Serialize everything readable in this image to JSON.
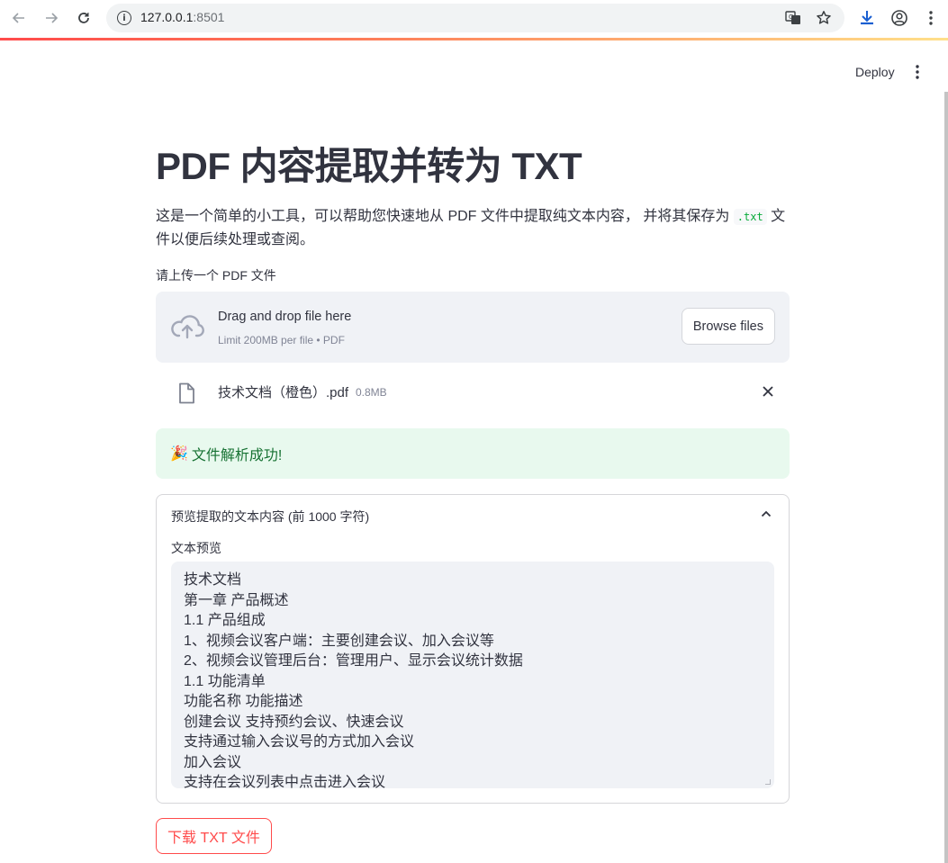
{
  "browser": {
    "url_host": "127.0.0.1",
    "url_port": ":8501"
  },
  "header": {
    "deploy_label": "Deploy"
  },
  "main": {
    "title": "PDF 内容提取并转为 TXT",
    "description_before": "这是一个简单的小工具，可以帮助您快速地从 PDF 文件中提取纯文本内容， 并将其保存为 ",
    "description_code": ".txt",
    "description_after": " 文件以便后续处理或查阅。",
    "upload_label": "请上传一个 PDF 文件",
    "dropzone": {
      "title": "Drag and drop file here",
      "subtitle": "Limit 200MB per file • PDF",
      "browse_label": "Browse files"
    },
    "file": {
      "name": "技术文档（橙色）.pdf",
      "size": "0.8MB"
    },
    "success": {
      "emoji": "🎉",
      "text": "文件解析成功!"
    },
    "expander": {
      "title": "预览提取的文本内容 (前 1000 字符)",
      "textarea_label": "文本预览",
      "lines": [
        "技术文档",
        "第一章 产品概述",
        "1.1 产品组成",
        "1、视频会议客户端：主要创建会议、加入会议等",
        "2、视频会议管理后台：管理用户、显示会议统计数据",
        "1.1 功能清单",
        "功能名称 功能描述",
        "创建会议 支持预约会议、快速会议",
        "支持通过输入会议号的方式加入会议",
        "加入会议",
        "支持在会议列表中点击进入会议"
      ]
    },
    "download_label": "下载 TXT 文件"
  },
  "colors": {
    "accent": "#ff4b4b",
    "success_bg": "#e8f9ee",
    "success_text": "#177233",
    "panel_bg": "#f0f2f6"
  }
}
